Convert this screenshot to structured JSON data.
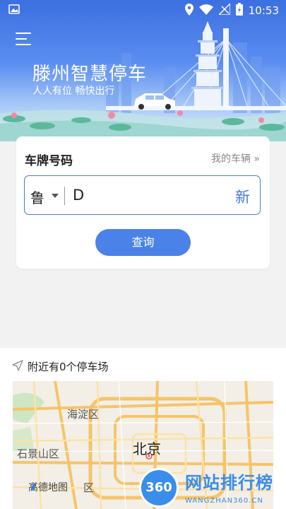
{
  "status_bar": {
    "time": "10:53"
  },
  "header": {
    "title": "滕州智慧停车",
    "subtitle": "人人有位 畅快出行"
  },
  "plate_card": {
    "title": "车牌号码",
    "my_vehicle_link": "我的车辆 »",
    "province": "鲁",
    "plate_value": "D",
    "new_energy_label": "新",
    "query_button": "查询"
  },
  "nearby": {
    "header": "附近有0个停车场",
    "map_labels": {
      "haidian": "海淀区",
      "shijingshan": "石景山区",
      "beijing": "北京",
      "district_partial": "区",
      "provider": "高德地图"
    }
  },
  "watermark": {
    "badge": "360",
    "name": "网站排行榜",
    "url": "WANGZHAN360.CN"
  },
  "colors": {
    "accent": "#4a78d9",
    "button": "#4a82e8",
    "hero_top": "#3c6fe0"
  }
}
